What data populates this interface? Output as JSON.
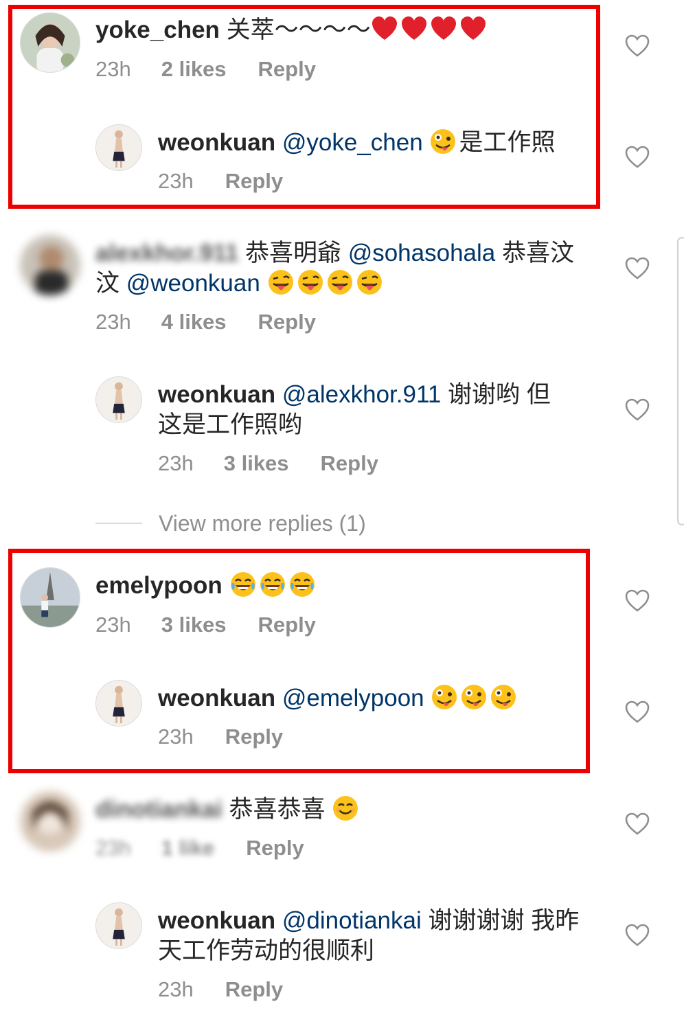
{
  "comments": [
    {
      "username": "yoke_chen",
      "text": " 关萃〜〜〜〜",
      "emojis": [
        "red-heart",
        "red-heart",
        "red-heart",
        "red-heart"
      ],
      "time": "23h",
      "likes": "2 likes",
      "reply": "Reply"
    },
    {
      "username": "weonkuan",
      "mention": "@yoke_chen",
      "text": "是工作照",
      "emojis_before_text": [
        "zany-face"
      ],
      "time": "23h",
      "reply": "Reply"
    },
    {
      "username": "alexkhor.911",
      "text_line1": " 恭喜明爺 ",
      "mention1": "@sohasohala",
      "text_mid": "  恭喜汶",
      "text_line2_start": "汶 ",
      "mention2": "@weonkuan",
      "emojis": [
        "tongue-wink",
        "tongue-wink",
        "tongue-wink",
        "tongue-wink"
      ],
      "time": "23h",
      "likes": "4 likes",
      "reply": "Reply"
    },
    {
      "username": "weonkuan",
      "mention": "@alexkhor.911",
      "text_line1": " 谢谢哟 但",
      "text_line2": "这是工作照哟",
      "time": "23h",
      "likes": "3 likes",
      "reply": "Reply"
    },
    {
      "username": "emelypoon",
      "emojis": [
        "tears-of-joy",
        "tears-of-joy",
        "tears-of-joy"
      ],
      "time": "23h",
      "likes": "3 likes",
      "reply": "Reply"
    },
    {
      "username": "weonkuan",
      "mention": "@emelypoon",
      "emojis": [
        "zany-face",
        "zany-face",
        "zany-face"
      ],
      "time": "23h",
      "reply": "Reply"
    },
    {
      "username": "dinotiankai",
      "text": " 恭喜恭喜 ",
      "emojis": [
        "smiling-face"
      ],
      "time": "23h",
      "likes": "1 like",
      "reply": "Reply"
    },
    {
      "username": "weonkuan",
      "mention": "@dinotiankai",
      "text_line1": " 谢谢谢谢 我昨",
      "text_line2": "天工作劳动的很顺利",
      "time": "23h",
      "reply": "Reply"
    }
  ],
  "view_more_replies": "View more replies (1)",
  "colors": {
    "highlight": "#ee0000",
    "text": "#262626",
    "meta": "#8e8e8e",
    "mention": "#003569"
  },
  "icons": {
    "like": "heart-outline-icon"
  }
}
